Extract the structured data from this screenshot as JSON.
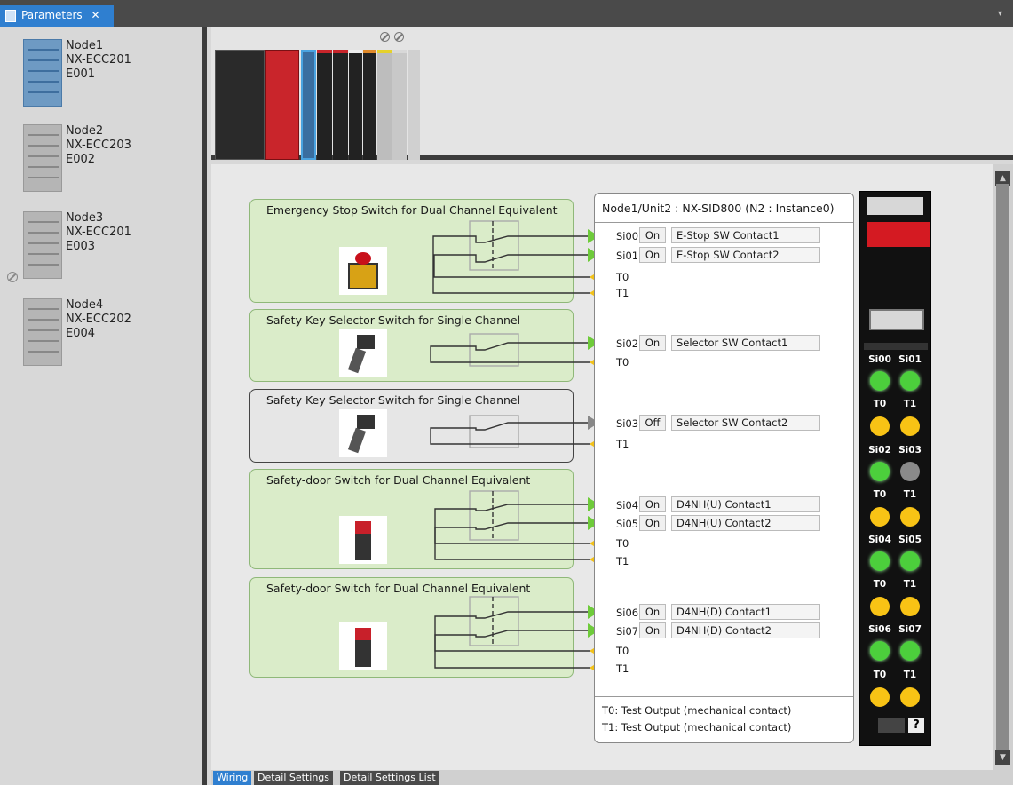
{
  "tab": {
    "label": "Parameters",
    "close": "✕",
    "menu": "▾"
  },
  "nodes": [
    {
      "name": "Node1",
      "model": "NX-ECC201",
      "id": "E001",
      "selected": true
    },
    {
      "name": "Node2",
      "model": "NX-ECC203",
      "id": "E002",
      "selected": false
    },
    {
      "name": "Node3",
      "model": "NX-ECC201",
      "id": "E003",
      "selected": false
    },
    {
      "name": "Node4",
      "model": "NX-ECC202",
      "id": "E004",
      "selected": false
    }
  ],
  "devices": [
    {
      "title": "Emergency Stop Switch for Dual Channel Equivalent",
      "enabled": true
    },
    {
      "title": "Safety Key Selector Switch for Single Channel",
      "enabled": true
    },
    {
      "title": "Safety Key Selector Switch for Single Channel",
      "enabled": false
    },
    {
      "title": "Safety-door Switch for Dual Channel Equivalent",
      "enabled": true
    },
    {
      "title": "Safety-door Switch for Dual Channel Equivalent",
      "enabled": true
    }
  ],
  "unit": {
    "header": "Node1/Unit2 : NX-SID800 (N2 : Instance0)",
    "io": [
      {
        "terminal": "Si00",
        "state": "On",
        "comment": "E-Stop SW Contact1"
      },
      {
        "terminal": "Si01",
        "state": "On",
        "comment": "E-Stop SW Contact2"
      },
      {
        "terminal": "T0"
      },
      {
        "terminal": "T1"
      },
      {
        "terminal": "Si02",
        "state": "On",
        "comment": "Selector SW Contact1"
      },
      {
        "terminal": "T0"
      },
      {
        "terminal": "Si03",
        "state": "Off",
        "comment": "Selector SW Contact2"
      },
      {
        "terminal": "T1"
      },
      {
        "terminal": "Si04",
        "state": "On",
        "comment": "D4NH(U) Contact1"
      },
      {
        "terminal": "Si05",
        "state": "On",
        "comment": "D4NH(U) Contact2"
      },
      {
        "terminal": "T0"
      },
      {
        "terminal": "T1"
      },
      {
        "terminal": "Si06",
        "state": "On",
        "comment": "D4NH(D) Contact1"
      },
      {
        "terminal": "Si07",
        "state": "On",
        "comment": "D4NH(D) Contact2"
      },
      {
        "terminal": "T0"
      },
      {
        "terminal": "T1"
      }
    ],
    "notes": [
      "T0: Test Output (mechanical contact)",
      "T1: Test Output (mechanical contact)"
    ]
  },
  "module": {
    "labels": [
      [
        "Si00",
        "Si01"
      ],
      [
        "T0",
        "T1"
      ],
      [
        "Si02",
        "Si03"
      ],
      [
        "T0",
        "T1"
      ],
      [
        "Si04",
        "Si05"
      ],
      [
        "T0",
        "T1"
      ],
      [
        "Si06",
        "Si07"
      ],
      [
        "T0",
        "T1"
      ]
    ],
    "leds": [
      [
        "g",
        "g"
      ],
      [
        "y",
        "y"
      ],
      [
        "g",
        "gr"
      ],
      [
        "y",
        "y"
      ],
      [
        "g",
        "g"
      ],
      [
        "y",
        "y"
      ],
      [
        "g",
        "g"
      ],
      [
        "y",
        "y"
      ]
    ],
    "help": "?"
  },
  "bottom_tabs": [
    "Wiring",
    "Detail Settings",
    "Detail Settings List"
  ],
  "colors": {
    "accent": "#2f7fd0",
    "on_green": "#4ccf3c",
    "test_yellow": "#f2c118",
    "device_fill": "#daecc9"
  }
}
